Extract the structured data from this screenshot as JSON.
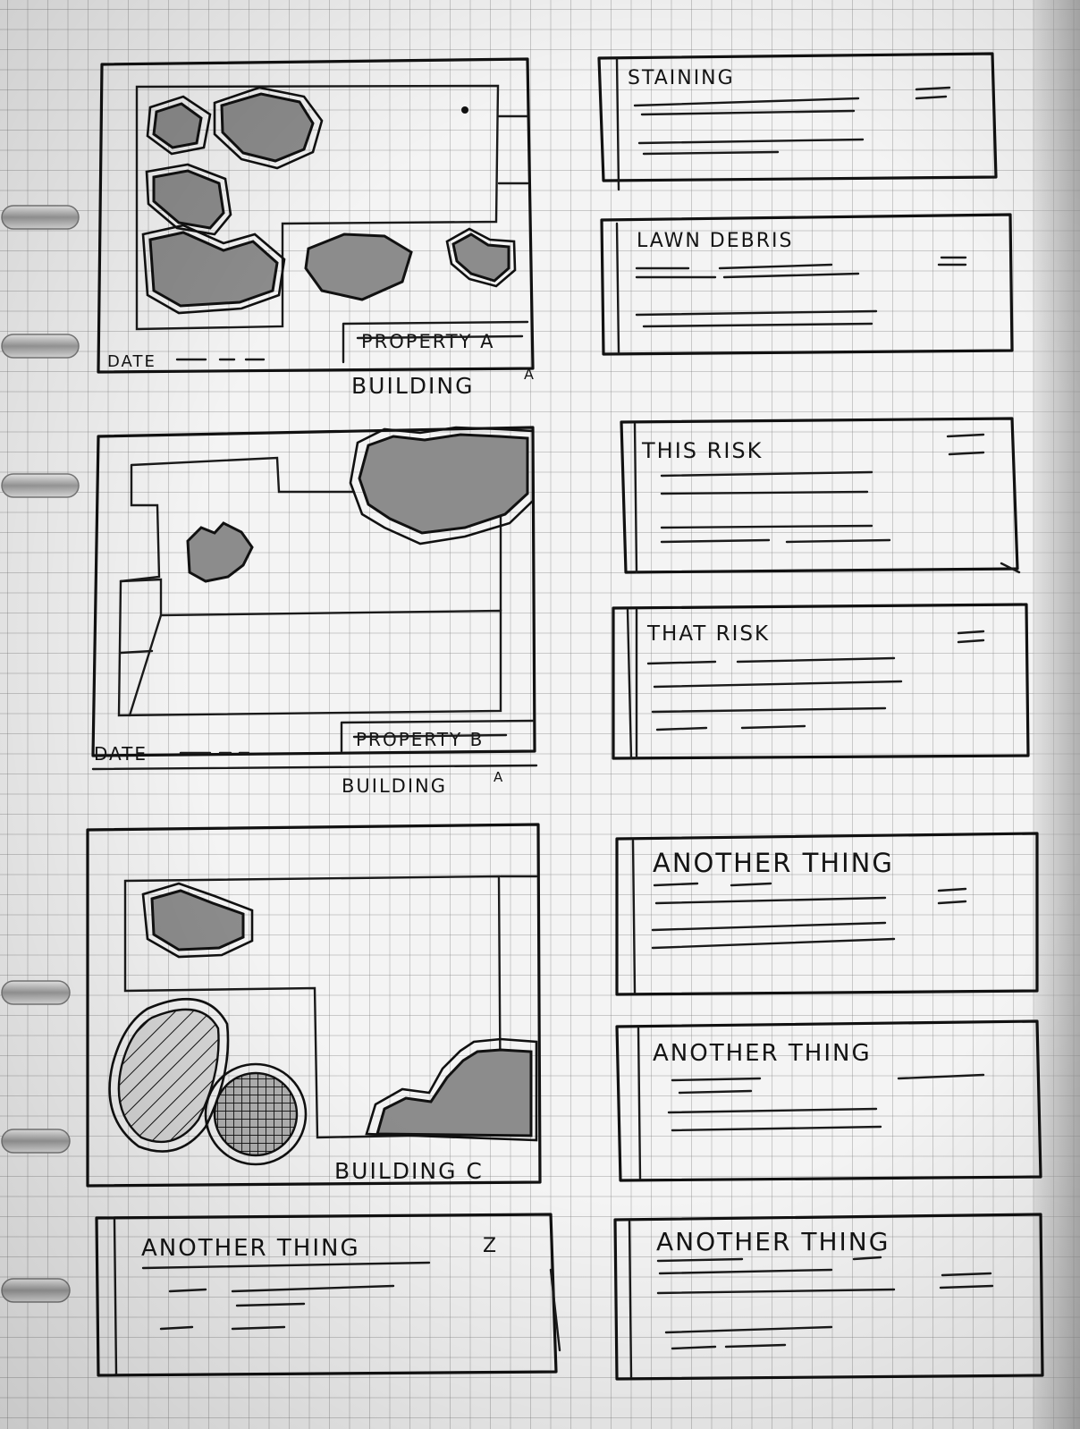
{
  "sketch": {
    "buildings": [
      {
        "property_label": "PROPERTY A",
        "building_label": "BUILDING",
        "building_mark": "A",
        "date_label": "DATE"
      },
      {
        "property_label": "PROPERTY B",
        "building_label": "BUILDING",
        "building_mark": "A",
        "date_label": "DATE"
      },
      {
        "building_label": "BUILDING C"
      }
    ],
    "cards": [
      {
        "title": "STAINING"
      },
      {
        "title": "LAWN DEBRIS"
      },
      {
        "title": "THIS RISK"
      },
      {
        "title": "THAT RISK"
      },
      {
        "title": "ANOTHER THING"
      },
      {
        "title": "ANOTHER THING"
      },
      {
        "title": "ANOTHER THING",
        "mark": "Z"
      },
      {
        "title": "ANOTHER THING"
      }
    ]
  }
}
